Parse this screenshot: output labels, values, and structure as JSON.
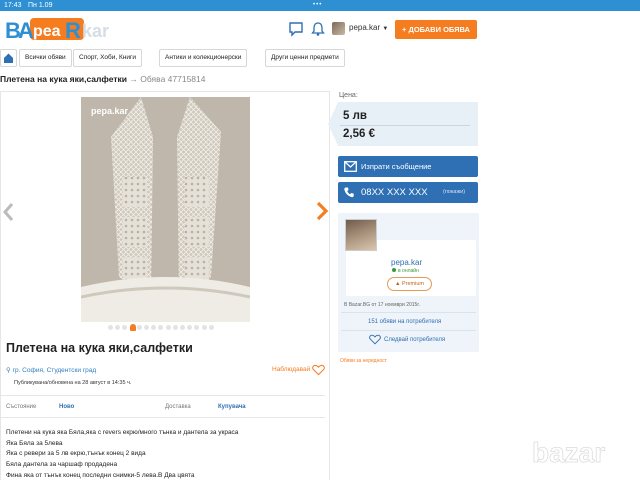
{
  "status_bar": {
    "time": "17:43",
    "date": "Пн 1.09",
    "dots": "•••"
  },
  "header": {
    "logo_text": "BAZAR",
    "username": "pepa.kar",
    "add_button": "+ ДОБАВИ ОБЯВА",
    "icons": [
      "chat-icon",
      "bell-icon",
      "home-icon",
      "caret-down-icon"
    ]
  },
  "categories": [
    "Всички обяви",
    "Спорт, Хоби, Книги",
    "Антики и колекционерски",
    "Други ценни предмети"
  ],
  "title_row": {
    "title": "Плетена на кука яки,салфетки",
    "arrow": "→",
    "ad_number": "Обява 47715814"
  },
  "photo": {
    "watermark": "pepa.kar",
    "dot_count": 15,
    "active_dot": 3
  },
  "ad": {
    "title": "Плетена на кука яки,салфетки",
    "location": "гр. София, Студентски град",
    "favorite": "Наблюдавай",
    "published": "Публикувана/обновена на 28 август в 14:35 ч.",
    "props": {
      "condition_label": "Състояние",
      "condition_value": "Ново",
      "delivery_label": "Доставка",
      "delivery_value": "Купувача"
    },
    "description": [
      "Плетени на кука яка Бяла,яка с revers екрю/много тънка и дантела за украса",
      "Яка Бяла за 5лева",
      "Яка с ревери за 5 лв екрю,тънък конец 2 вида",
      "Бяла дантела за чаршаф продадена",
      "Фина яка от тънък конец последни снимки-5 лева.В Два цвята"
    ]
  },
  "price": {
    "label": "Цена:",
    "lv": "5 лв",
    "eur": "2,56 €"
  },
  "contact": {
    "message_button": "Изпрати съобщение",
    "phone": "08XX XXX XXX",
    "show_phone": "(покажи)"
  },
  "seller": {
    "name": "pepa.kar",
    "status": "в онлайн",
    "badge": "Premium",
    "member_since": "В Bazar.BG от 17 ноември 2015г.",
    "ads_link": "151 обяви на потребителя",
    "follow_link": "Следвай потребителя"
  },
  "report_link": "Обяви за нередност",
  "colors": {
    "accent_orange": "#f57c1f",
    "primary_blue": "#2f6fb3",
    "status_blue": "#2f8fd3",
    "price_bg": "#e8f0f7"
  }
}
